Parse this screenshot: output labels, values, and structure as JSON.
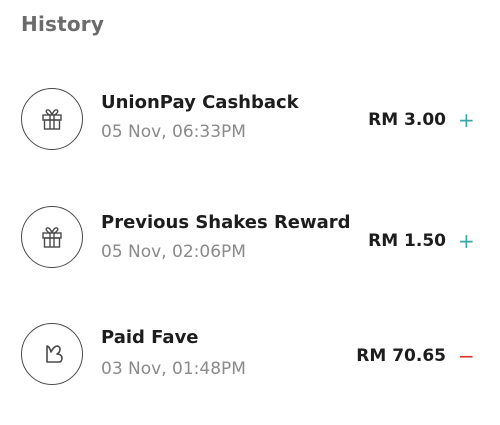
{
  "history": {
    "title": "History",
    "items": [
      {
        "icon": "gift-icon",
        "title": "UnionPay Cashback",
        "date": "05 Nov, 06:33PM",
        "amount": "RM 3.00",
        "sign": "+",
        "sign_color": "#3aa6a6"
      },
      {
        "icon": "gift-icon",
        "title": "Previous Shakes Reward",
        "date": "05 Nov, 02:06PM",
        "amount": "RM 1.50",
        "sign": "+",
        "sign_color": "#3aa6a6"
      },
      {
        "icon": "heart-icon",
        "title": "Paid Fave",
        "date": "03 Nov, 01:48PM",
        "amount": "RM 70.65",
        "sign": "−",
        "sign_color": "#e0322c"
      }
    ]
  }
}
